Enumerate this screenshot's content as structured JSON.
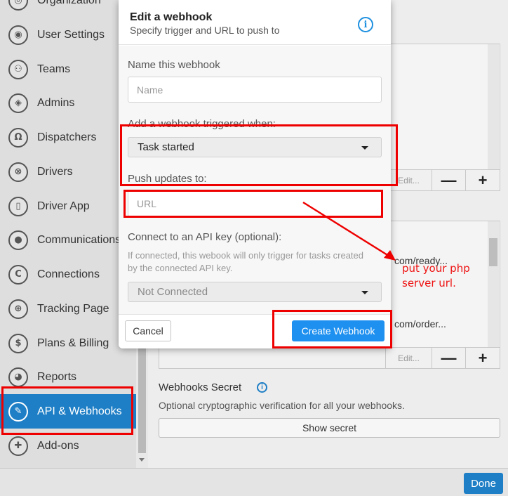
{
  "sidebar": {
    "items": [
      {
        "label": "Organization",
        "icon": "org-icon",
        "glyph": "◎"
      },
      {
        "label": "User Settings",
        "icon": "user-icon",
        "glyph": "◉"
      },
      {
        "label": "Teams",
        "icon": "team-icon",
        "glyph": "⚇"
      },
      {
        "label": "Admins",
        "icon": "shield-icon",
        "glyph": "◈"
      },
      {
        "label": "Dispatchers",
        "icon": "headset-icon",
        "glyph": "Ω"
      },
      {
        "label": "Drivers",
        "icon": "steering-wheel-icon",
        "glyph": "⊗"
      },
      {
        "label": "Driver App",
        "icon": "phone-icon",
        "glyph": "▯"
      },
      {
        "label": "Communications",
        "icon": "chat-bubble-icon",
        "glyph": "●"
      },
      {
        "label": "Connections",
        "icon": "plug-icon",
        "glyph": "C"
      },
      {
        "label": "Tracking Page",
        "icon": "crosshair-icon",
        "glyph": "⊕"
      },
      {
        "label": "Plans & Billing",
        "icon": "dollar-icon",
        "glyph": "$"
      },
      {
        "label": "Reports",
        "icon": "pie-chart-icon",
        "glyph": "◕"
      },
      {
        "label": "API & Webhooks",
        "icon": "wrench-icon",
        "glyph": "✎"
      },
      {
        "label": "Add-ons",
        "icon": "puzzle-icon",
        "glyph": "✚"
      }
    ]
  },
  "keys_list": {
    "edit_label": "Edit...",
    "remove_label": "—",
    "add_label": "+"
  },
  "webhooks_list": {
    "rows": [
      "com/ready...",
      "com/order..."
    ],
    "edit_label": "Edit...",
    "remove_label": "—",
    "add_label": "+"
  },
  "secret": {
    "title": "Webhooks Secret",
    "info_glyph": "i",
    "description": "Optional cryptographic verification for all your webhooks.",
    "button_label": "Show secret"
  },
  "footer": {
    "done_label": "Done"
  },
  "modal": {
    "title": "Edit a webhook",
    "subtitle": "Specify trigger and URL to push to",
    "info_glyph": "i",
    "name_label": "Name this webhook",
    "name_placeholder": "Name",
    "trigger_label": "Add a webhook triggered when:",
    "trigger_value": "Task started",
    "push_label": "Push updates to:",
    "url_placeholder": "URL",
    "api_key_label": "Connect to an API key (optional):",
    "api_key_help": "If connected, this webook will only trigger for tasks created by the connected API key.",
    "api_key_value": "Not Connected",
    "cancel_label": "Cancel",
    "create_label": "Create Webhook"
  },
  "annotation": {
    "note": "put your php server url.",
    "color": "#ee0000"
  },
  "colors": {
    "accent": "#1e7fc6",
    "primary_button": "#1e90f0"
  }
}
